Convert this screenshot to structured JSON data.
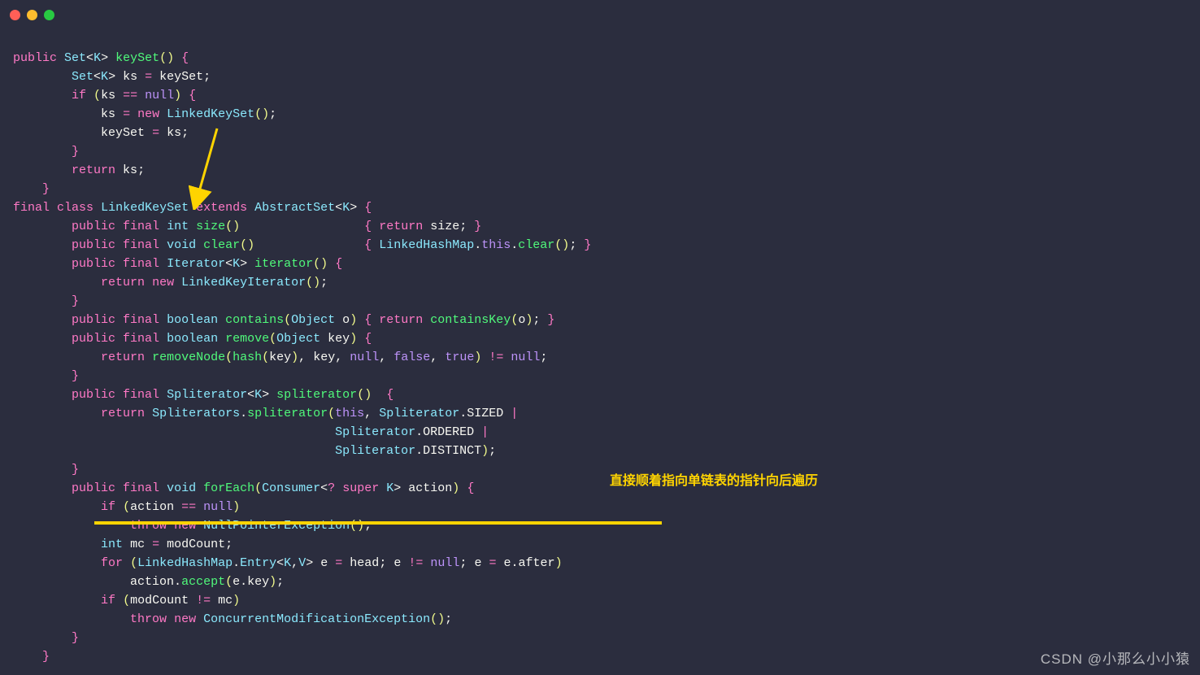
{
  "annotation": "直接顺着指向单链表的指针向后遍历",
  "watermark": "CSDN @小那么小小猿",
  "colors": {
    "bg": "#2b2d3e",
    "keyword": "#ff79c6",
    "type": "#8be9fd",
    "identifier": "#f8f8f2",
    "method": "#50fa7b",
    "paren": "#f1fa8c",
    "literal": "#bd93f9",
    "highlight": "#ffd400"
  },
  "traffic_lights": {
    "close": "#ff5f57",
    "minimize": "#ffbd2e",
    "maximize": "#28ca42"
  },
  "code": {
    "l1_public": "public",
    "l1_set": "Set",
    "l1_k": "K",
    "l1_keyset": "keySet",
    "l2_set": "Set",
    "l2_k": "K",
    "l2_ks": "ks",
    "l2_keyset": "keySet",
    "l3_if": "if",
    "l3_ks": "ks",
    "l3_null": "null",
    "l4_ks": "ks",
    "l4_new": "new",
    "l4_lks": "LinkedKeySet",
    "l5_keyset": "keySet",
    "l5_ks": "ks",
    "l7_return": "return",
    "l7_ks": "ks",
    "l9_final": "final",
    "l9_class": "class",
    "l9_lks": "LinkedKeySet",
    "l9_extends": "extends",
    "l9_abs": "AbstractSet",
    "l9_k": "K",
    "l10_public": "public",
    "l10_final": "final",
    "l10_int": "int",
    "l10_size": "size",
    "l10_return": "return",
    "l10_sizev": "size",
    "l11_public": "public",
    "l11_final": "final",
    "l11_void": "void",
    "l11_clear": "clear",
    "l11_lhm": "LinkedHashMap",
    "l11_this": "this",
    "l11_clearc": "clear",
    "l12_public": "public",
    "l12_final": "final",
    "l12_iter": "Iterator",
    "l12_k": "K",
    "l12_iterm": "iterator",
    "l13_return": "return",
    "l13_new": "new",
    "l13_lki": "LinkedKeyIterator",
    "l15_public": "public",
    "l15_final": "final",
    "l15_bool": "boolean",
    "l15_contains": "contains",
    "l15_obj": "Object",
    "l15_o": "o",
    "l15_return": "return",
    "l15_ck": "containsKey",
    "l15_o2": "o",
    "l16_public": "public",
    "l16_final": "final",
    "l16_bool": "boolean",
    "l16_remove": "remove",
    "l16_obj": "Object",
    "l16_key": "key",
    "l17_return": "return",
    "l17_rn": "removeNode",
    "l17_hash": "hash",
    "l17_key": "key",
    "l17_key2": "key",
    "l17_null": "null",
    "l17_false": "false",
    "l17_true": "true",
    "l17_null2": "null",
    "l19_public": "public",
    "l19_final": "final",
    "l19_split": "Spliterator",
    "l19_k": "K",
    "l19_splitm": "spliterator",
    "l20_return": "return",
    "l20_splits": "Spliterators",
    "l20_splitm": "spliterator",
    "l20_this": "this",
    "l20_splitc": "Spliterator",
    "l20_sized": "SIZED",
    "l21_splitc": "Spliterator",
    "l21_ordered": "ORDERED",
    "l22_splitc": "Spliterator",
    "l22_distinct": "DISTINCT",
    "l24_public": "public",
    "l24_final": "final",
    "l24_void": "void",
    "l24_foreach": "forEach",
    "l24_consumer": "Consumer",
    "l24_super": "super",
    "l24_k": "K",
    "l24_action": "action",
    "l25_if": "if",
    "l25_action": "action",
    "l25_null": "null",
    "l26_throw": "throw",
    "l26_new": "new",
    "l26_npe": "NullPointerException",
    "l27_int": "int",
    "l27_mc": "mc",
    "l27_modcount": "modCount",
    "l28_for": "for",
    "l28_lhm": "LinkedHashMap",
    "l28_entry": "Entry",
    "l28_k": "K",
    "l28_v": "V",
    "l28_e": "e",
    "l28_head": "head",
    "l28_e2": "e",
    "l28_null": "null",
    "l28_e3": "e",
    "l28_e4": "e",
    "l28_after": "after",
    "l29_action": "action",
    "l29_accept": "accept",
    "l29_e": "e",
    "l29_key": "key",
    "l30_if": "if",
    "l30_modcount": "modCount",
    "l30_mc": "mc",
    "l31_throw": "throw",
    "l31_new": "new",
    "l31_cme": "ConcurrentModificationException"
  }
}
